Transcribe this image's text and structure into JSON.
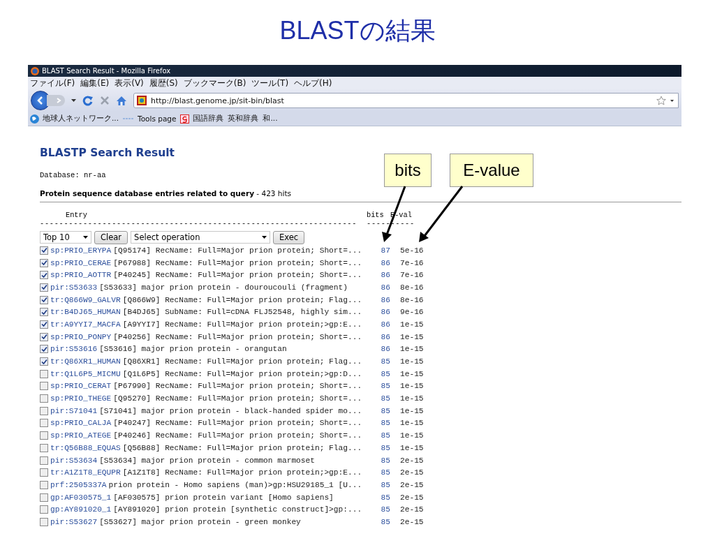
{
  "slide": {
    "title": "BLASTの結果"
  },
  "browser": {
    "title": "BLAST Search Result - Mozilla Firefox",
    "menu": [
      "ファイル(F)",
      "編集(E)",
      "表示(V)",
      "履歴(S)",
      "ブックマーク(B)",
      "ツール(T)",
      "ヘルプ(H)"
    ],
    "url": "http://blast.genome.jp/sit-bin/blast",
    "bookmarks": [
      {
        "label": "地球人ネットワーク...",
        "kind": "globe"
      },
      {
        "label": "Tools page",
        "kind": "line"
      },
      {
        "label": "国語辞典",
        "kind": "g"
      },
      {
        "label": "英和辞典",
        "kind": "none"
      },
      {
        "label": "和...",
        "kind": "none"
      }
    ]
  },
  "page": {
    "heading": "BLASTP Search Result",
    "database": "Database: nr-aa",
    "summary": "**Protein sequence database entries related to query** - 423 hits",
    "columns": [
      "Entry",
      "bits",
      "E-val"
    ],
    "rules": [
      "------------------------------------------------------------------",
      "----------"
    ],
    "controls": {
      "count": "Top 10",
      "clear": "Clear",
      "operation": "Select operation",
      "exec": "Exec"
    },
    "rows": [
      {
        "id": "sp:PRIO_ERYPA",
        "desc": "[Q95174] RecName: Full=Major prion protein; Short=...",
        "bits": "87",
        "evalue": "5e-16",
        "checked": true
      },
      {
        "id": "sp:PRIO_CERAE",
        "desc": "[P67988] RecName: Full=Major prion protein; Short=...",
        "bits": "86",
        "evalue": "7e-16",
        "checked": true
      },
      {
        "id": "sp:PRIO_AOTTR",
        "desc": "[P40245] RecName: Full=Major prion protein; Short=...",
        "bits": "86",
        "evalue": "7e-16",
        "checked": true
      },
      {
        "id": "pir:S53633",
        "desc": "[S53633] major prion protein - douroucouli (fragment)",
        "bits": "86",
        "evalue": "8e-16",
        "checked": true
      },
      {
        "id": "tr:Q866W9_GALVR",
        "desc": "[Q866W9] RecName: Full=Major prion protein; Flag...",
        "bits": "86",
        "evalue": "8e-16",
        "checked": true
      },
      {
        "id": "tr:B4DJ65_HUMAN",
        "desc": "[B4DJ65] SubName: Full=cDNA FLJ52548, highly sim...",
        "bits": "86",
        "evalue": "9e-16",
        "checked": true
      },
      {
        "id": "tr:A9YYI7_MACFA",
        "desc": "[A9YYI7] RecName: Full=Major prion protein;>gp:E...",
        "bits": "86",
        "evalue": "1e-15",
        "checked": true
      },
      {
        "id": "sp:PRIO_PONPY",
        "desc": "[P40256] RecName: Full=Major prion protein; Short=...",
        "bits": "86",
        "evalue": "1e-15",
        "checked": true
      },
      {
        "id": "pir:S53616",
        "desc": "[S53616] major prion protein - orangutan",
        "bits": "86",
        "evalue": "1e-15",
        "checked": true
      },
      {
        "id": "tr:Q86XR1_HUMAN",
        "desc": "[Q86XR1] RecName: Full=Major prion protein; Flag...",
        "bits": "85",
        "evalue": "1e-15",
        "checked": true
      },
      {
        "id": "tr:Q1L6P5_MICMU",
        "desc": "[Q1L6P5] RecName: Full=Major prion protein;>gp:D...",
        "bits": "85",
        "evalue": "1e-15",
        "checked": false
      },
      {
        "id": "sp:PRIO_CERAT",
        "desc": "[P67990] RecName: Full=Major prion protein; Short=...",
        "bits": "85",
        "evalue": "1e-15",
        "checked": false
      },
      {
        "id": "sp:PRIO_THEGE",
        "desc": "[Q95270] RecName: Full=Major prion protein; Short=...",
        "bits": "85",
        "evalue": "1e-15",
        "checked": false
      },
      {
        "id": "pir:S71041",
        "desc": "[S71041] major prion protein - black-handed spider mo...",
        "bits": "85",
        "evalue": "1e-15",
        "checked": false
      },
      {
        "id": "sp:PRIO_CALJA",
        "desc": "[P40247] RecName: Full=Major prion protein; Short=...",
        "bits": "85",
        "evalue": "1e-15",
        "checked": false
      },
      {
        "id": "sp:PRIO_ATEGE",
        "desc": "[P40246] RecName: Full=Major prion protein; Short=...",
        "bits": "85",
        "evalue": "1e-15",
        "checked": false
      },
      {
        "id": "tr:Q56B88_EQUAS",
        "desc": "[Q56B88] RecName: Full=Major prion protein; Flag...",
        "bits": "85",
        "evalue": "1e-15",
        "checked": false
      },
      {
        "id": "pir:S53634",
        "desc": "[S53634] major prion protein - common marmoset",
        "bits": "85",
        "evalue": "2e-15",
        "checked": false
      },
      {
        "id": "tr:A1Z1T8_EQUPR",
        "desc": "[A1Z1T8] RecName: Full=Major prion protein;>gp:E...",
        "bits": "85",
        "evalue": "2e-15",
        "checked": false
      },
      {
        "id": "prf:2505337A",
        "desc": "prion protein - Homo sapiens (man)>gp:HSU29185_1 [U...",
        "bits": "85",
        "evalue": "2e-15",
        "checked": false
      },
      {
        "id": "gp:AF030575_1",
        "desc": "[AF030575] prion protein variant [Homo sapiens]",
        "bits": "85",
        "evalue": "2e-15",
        "checked": false
      },
      {
        "id": "gp:AY891020_1",
        "desc": "[AY891020] prion protein [synthetic construct]>gp:...",
        "bits": "85",
        "evalue": "2e-15",
        "checked": false
      },
      {
        "id": "pir:S53627",
        "desc": "[S53627] major prion protein - green monkey",
        "bits": "85",
        "evalue": "2e-15",
        "checked": false
      }
    ]
  },
  "callouts": [
    {
      "text": "bits"
    },
    {
      "text": "E-value"
    }
  ]
}
